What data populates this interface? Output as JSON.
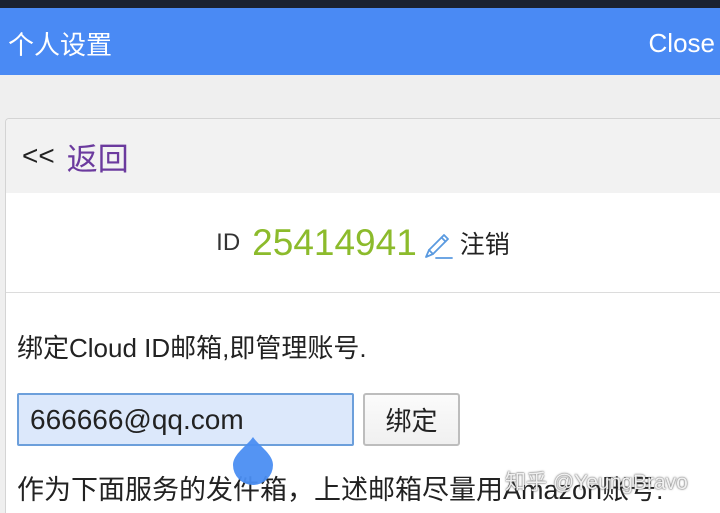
{
  "window": {
    "title": "个人设置",
    "close_label": "Close"
  },
  "nav": {
    "back_arrows": "<<",
    "back_label": "返回"
  },
  "account": {
    "id_label": "ID",
    "id_value": "25414941",
    "logout_label": "注销"
  },
  "bind_email": {
    "description": "绑定Cloud ID邮箱,即管理账号.",
    "email_value": "666666@qq.com",
    "bind_button_label": "绑定",
    "note": "作为下面服务的发件箱，上述邮箱尽量用Amazon账号."
  },
  "watermark": "知乎 @YeungBravo",
  "icons": {
    "edit": "pencil-icon",
    "cursor_handle": "text-cursor-handle-icon"
  },
  "colors": {
    "status_bar": "#1b2230",
    "header": "#4a8af4",
    "header_text": "#ffffff",
    "back_link": "#6b3a9e",
    "id_value": "#8cbb2c",
    "icon_blue": "#5a9ae0",
    "input_bg": "#dce8fb",
    "input_border": "#6c9fdb",
    "cursor_handle": "#4b8ef2"
  }
}
